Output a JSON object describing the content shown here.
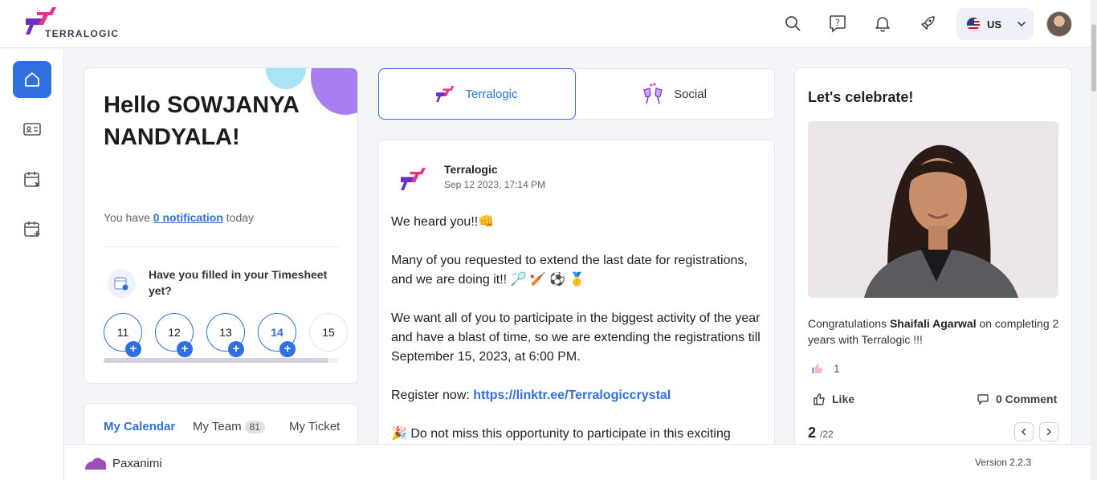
{
  "brand": {
    "name": "TERRALOGIC"
  },
  "header": {
    "language": "US",
    "icons": [
      "search-icon",
      "help-chat-icon",
      "bell-icon",
      "rocket-icon",
      "chevron-down-icon"
    ]
  },
  "sidebar": {
    "items": [
      {
        "name": "home",
        "icon": "home-icon",
        "active": true
      },
      {
        "name": "profile",
        "icon": "id-card-icon"
      },
      {
        "name": "leave",
        "icon": "calendar-x-icon"
      },
      {
        "name": "add-leave",
        "icon": "calendar-plus-icon"
      }
    ]
  },
  "welcome": {
    "greeting": "Hello SOWJANYA NANDYALA!",
    "notif_prefix": "You have ",
    "notif_link": "0 notification",
    "notif_suffix": " today",
    "timesheet_question": "Have you filled in your Timesheet yet?",
    "days": [
      "11",
      "12",
      "13",
      "14",
      "15"
    ]
  },
  "calendar_tabs": {
    "my_calendar": "My Calendar",
    "my_team": "My Team",
    "my_team_count": "81",
    "my_ticket": "My Ticket"
  },
  "feed": {
    "tabs": {
      "terralogic": "Terralogic",
      "social": "Social"
    },
    "post": {
      "author": "Terralogic",
      "date": "Sep 12 2023, 17:14 PM",
      "p1": "We heard you!!👊",
      "p2": "Many of you requested to extend the last date for registrations, and we are doing it!! 🏸 🏏 ⚽ 🥇",
      "p3": "We want all of you to participate in the biggest activity of the year and have a blast of time, so we are extending the registrations till September 15, 2023, at 6:00 PM.",
      "p4_prefix": "Register now: ",
      "p4_link": "https://linktr.ee/Terralogiccrystal",
      "p5": "🎉 Do not miss this opportunity to participate in this exciting"
    }
  },
  "celebrate": {
    "title": "Let's celebrate!",
    "text_prefix": "Congratulations ",
    "person": "Shaifali Agarwal",
    "text_suffix": " on completing 2 years with Terralogic !!!",
    "like_count": "1",
    "like_label": "Like",
    "comment_label": "0 Comment",
    "page": "2",
    "page_total": "/22"
  },
  "footer": {
    "product": "Paxanimi",
    "version": "Version 2.2.3"
  },
  "colors": {
    "accent": "#2f6fe0",
    "brand_pink": "#e8318a",
    "brand_purple": "#7b3bd6"
  }
}
